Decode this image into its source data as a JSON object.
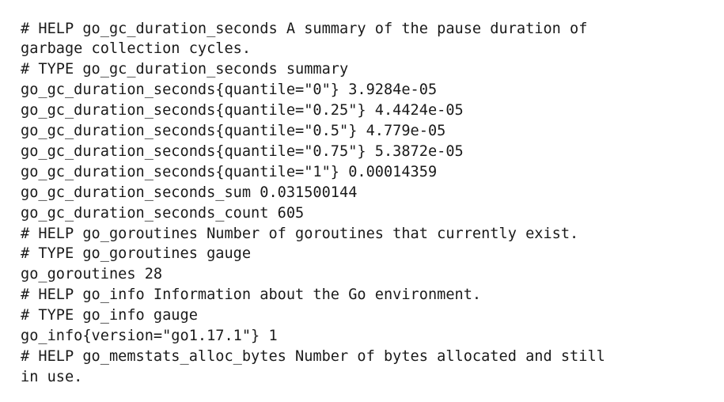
{
  "metrics_page": {
    "lines": [
      "# HELP go_gc_duration_seconds A summary of the pause duration of",
      "garbage collection cycles.",
      "# TYPE go_gc_duration_seconds summary",
      "go_gc_duration_seconds{quantile=\"0\"} 3.9284e-05",
      "go_gc_duration_seconds{quantile=\"0.25\"} 4.4424e-05",
      "go_gc_duration_seconds{quantile=\"0.5\"} 4.779e-05",
      "go_gc_duration_seconds{quantile=\"0.75\"} 5.3872e-05",
      "go_gc_duration_seconds{quantile=\"1\"} 0.00014359",
      "go_gc_duration_seconds_sum 0.031500144",
      "go_gc_duration_seconds_count 605",
      "# HELP go_goroutines Number of goroutines that currently exist.",
      "# TYPE go_goroutines gauge",
      "go_goroutines 28",
      "# HELP go_info Information about the Go environment.",
      "# TYPE go_info gauge",
      "go_info{version=\"go1.17.1\"} 1",
      "# HELP go_memstats_alloc_bytes Number of bytes allocated and still",
      "in use."
    ]
  }
}
